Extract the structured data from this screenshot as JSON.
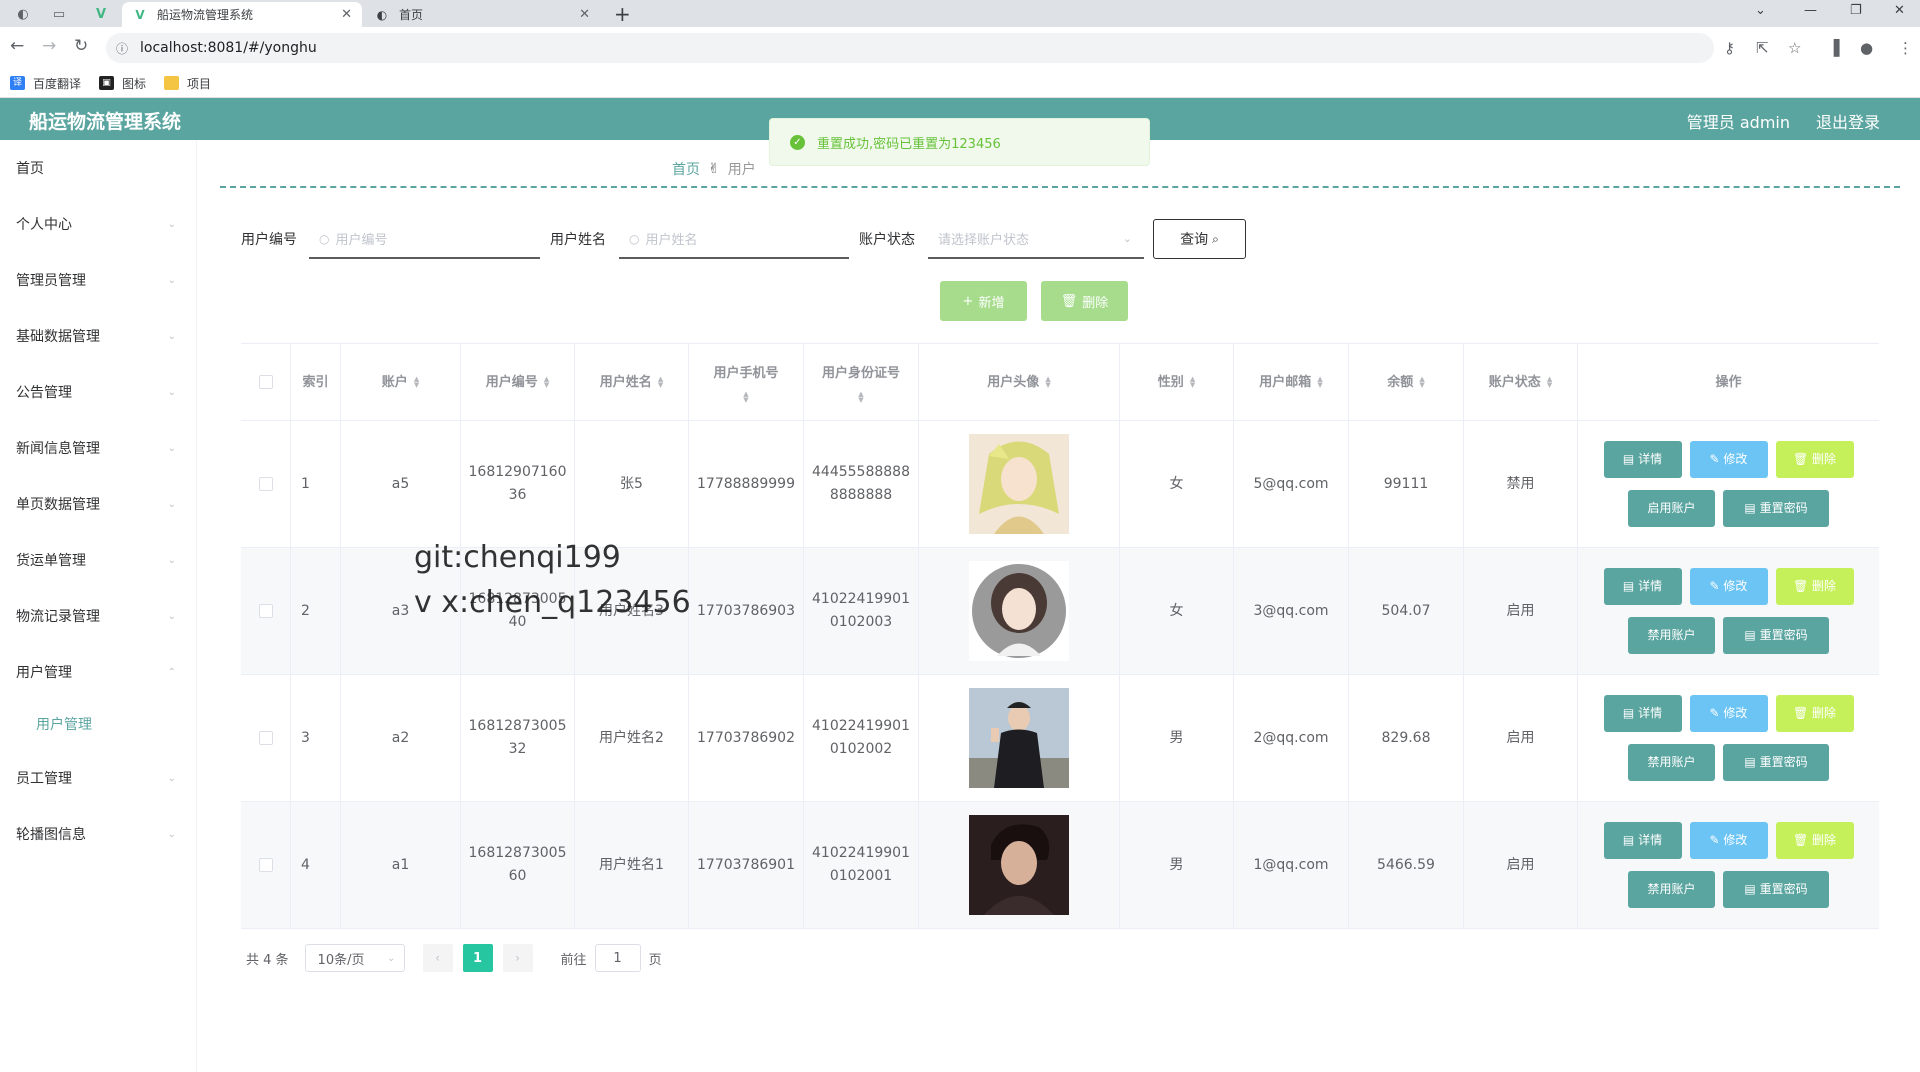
{
  "browser": {
    "tabs": [
      {
        "title": "船运物流管理系统",
        "active": true
      },
      {
        "title": "首页",
        "active": false
      }
    ],
    "url": "localhost:8081/#/yonghu",
    "bookmarks": [
      "百度翻译",
      "图标",
      "项目"
    ]
  },
  "header": {
    "title": "船运物流管理系统",
    "user": "管理员 admin",
    "logout": "退出登录"
  },
  "toast": {
    "message": "重置成功,密码已重置为123456"
  },
  "sidebar": {
    "items": [
      "首页",
      "个人中心",
      "管理员管理",
      "基础数据管理",
      "公告管理",
      "新闻信息管理",
      "单页数据管理",
      "货运单管理",
      "物流记录管理",
      "用户管理",
      "员工管理",
      "轮播图信息"
    ],
    "sub_item": "用户管理"
  },
  "breadcrumb": {
    "home": "首页",
    "current": "用户"
  },
  "search": {
    "user_no_label": "用户编号",
    "user_no_placeholder": "用户编号",
    "user_name_label": "用户姓名",
    "user_name_placeholder": "用户姓名",
    "status_label": "账户状态",
    "status_placeholder": "请选择账户状态",
    "query_label": "查询"
  },
  "actions": {
    "add_label": "新增",
    "delete_label": "删除"
  },
  "table": {
    "headers": {
      "index": "索引",
      "account": "账户",
      "user_no": "用户编号",
      "user_name": "用户姓名",
      "phone": "用户手机号",
      "id_card": "用户身份证号",
      "avatar": "用户头像",
      "gender": "性别",
      "email": "用户邮箱",
      "balance": "余额",
      "status": "账户状态",
      "ops": "操作"
    },
    "rows": [
      {
        "index": "1",
        "account": "a5",
        "user_no_1": "16812907160",
        "user_no_2": "36",
        "user_name": "张5",
        "phone": "17788889999",
        "id_1": "44455588888",
        "id_2": "8888888",
        "gender": "女",
        "email": "5@qq.com",
        "balance": "99111",
        "status": "禁用",
        "toggle": "启用账户"
      },
      {
        "index": "2",
        "account": "a3",
        "user_no_1": "16812873005",
        "user_no_2": "40",
        "user_name": "用户姓名3",
        "phone": "17703786903",
        "id_1": "41022419901",
        "id_2": "0102003",
        "gender": "女",
        "email": "3@qq.com",
        "balance": "504.07",
        "status": "启用",
        "toggle": "禁用账户"
      },
      {
        "index": "3",
        "account": "a2",
        "user_no_1": "16812873005",
        "user_no_2": "32",
        "user_name": "用户姓名2",
        "phone": "17703786902",
        "id_1": "41022419901",
        "id_2": "0102002",
        "gender": "男",
        "email": "2@qq.com",
        "balance": "829.68",
        "status": "启用",
        "toggle": "禁用账户"
      },
      {
        "index": "4",
        "account": "a1",
        "user_no_1": "16812873005",
        "user_no_2": "60",
        "user_name": "用户姓名1",
        "phone": "17703786901",
        "id_1": "41022419901",
        "id_2": "0102001",
        "gender": "男",
        "email": "1@qq.com",
        "balance": "5466.59",
        "status": "启用",
        "toggle": "禁用账户"
      }
    ],
    "row_ops": {
      "detail": "详情",
      "edit": "修改",
      "delete": "删除",
      "reset": "重置密码"
    }
  },
  "pagination": {
    "total": "共 4 条",
    "page_size": "10条/页",
    "current": "1",
    "goto": "前往",
    "goto_value": "1",
    "page_unit": "页"
  },
  "watermark": {
    "line1": "git:chenqi199",
    "line2": "v x:chen_q123456"
  }
}
